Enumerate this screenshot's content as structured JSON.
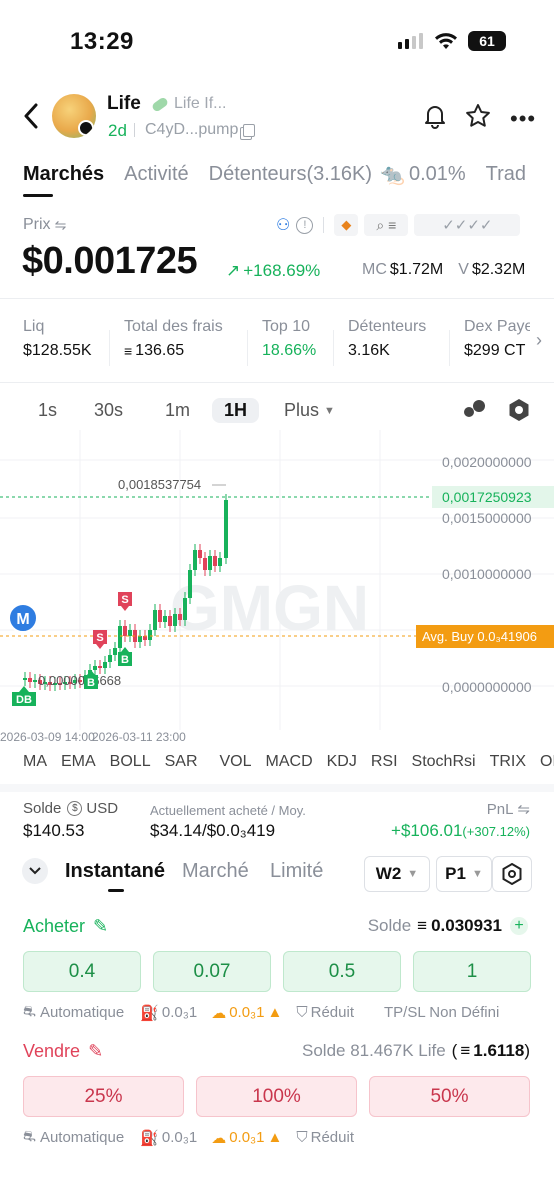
{
  "status": {
    "time": "13:29",
    "battery": "61"
  },
  "header": {
    "name": "Life",
    "subtitle": "Life If...",
    "age": "2d",
    "address": "C4yD...pump"
  },
  "tabs": [
    "Marchés",
    "Activité",
    "Détenteurs(3.16K)",
    "0.01%",
    "Trad"
  ],
  "price": {
    "label": "Prix",
    "value": "$0.001725",
    "change": "+168.69%",
    "mc_label": "MC",
    "mc": "$1.72M",
    "v_label": "V",
    "v": "$2.32M"
  },
  "stats": [
    {
      "label": "Liq",
      "value": "$128.55K"
    },
    {
      "label": "Total des frais",
      "value": "136.65"
    },
    {
      "label": "Top 10",
      "value": "18.66%"
    },
    {
      "label": "Détenteurs",
      "value": "3.16K"
    },
    {
      "label": "Dex Paye",
      "value": "$299 CT"
    }
  ],
  "timeframes": [
    "1s",
    "30s",
    "1m",
    "1H",
    "Plus"
  ],
  "chart": {
    "y_ticks": [
      "0,0020000000",
      "0,0015000000",
      "0,0010000000",
      "0,0000000000"
    ],
    "current_price": "0,0017250923",
    "high_label": "0,0018537754",
    "low_label": "0,0000026668",
    "avg_buy": "Avg. Buy 0.0₃41906",
    "x_ticks": [
      "2026-03-09 14:00",
      "2026-03-11 23:00"
    ],
    "watermark": "GMGN",
    "markers": {
      "m": "M",
      "db": "DB",
      "s": "S",
      "b": "B"
    }
  },
  "indicators": [
    "MA",
    "EMA",
    "BOLL",
    "SAR",
    "VOL",
    "MACD",
    "KDJ",
    "RSI",
    "StochRsi",
    "TRIX",
    "OB"
  ],
  "position": {
    "solde_label": "Solde",
    "solde_unit": "USD",
    "solde": "$140.53",
    "bought_label": "Actuellement acheté / Moy.",
    "bought": "$34.14/$0.0₃419",
    "pnl_label": "PnL",
    "pnl": "+$106.01",
    "pnl_pct": "(+307.12%)"
  },
  "order_tabs": [
    "Instantané",
    "Marché",
    "Limité"
  ],
  "selectors": {
    "wallet": "W2",
    "preset": "P1"
  },
  "buy": {
    "label": "Acheter",
    "balance_label": "Solde",
    "balance": "0.030931",
    "amounts": [
      "0.4",
      "0.07",
      "0.5",
      "1"
    ],
    "options": [
      "Automatique",
      "0.0₃1",
      "0.0₃1",
      "Réduit",
      "TP/SL Non Défini"
    ]
  },
  "sell": {
    "label": "Vendre",
    "balance_text": "Solde 81.467K Life",
    "balance_sol": "1.6118",
    "amounts": [
      "25%",
      "100%",
      "50%"
    ],
    "options": [
      "Automatique",
      "0.0₃1",
      "0.0₃1",
      "Réduit"
    ]
  },
  "colors": {
    "up": "#17b25b",
    "down": "#e0435a",
    "avg": "#f39c12"
  }
}
